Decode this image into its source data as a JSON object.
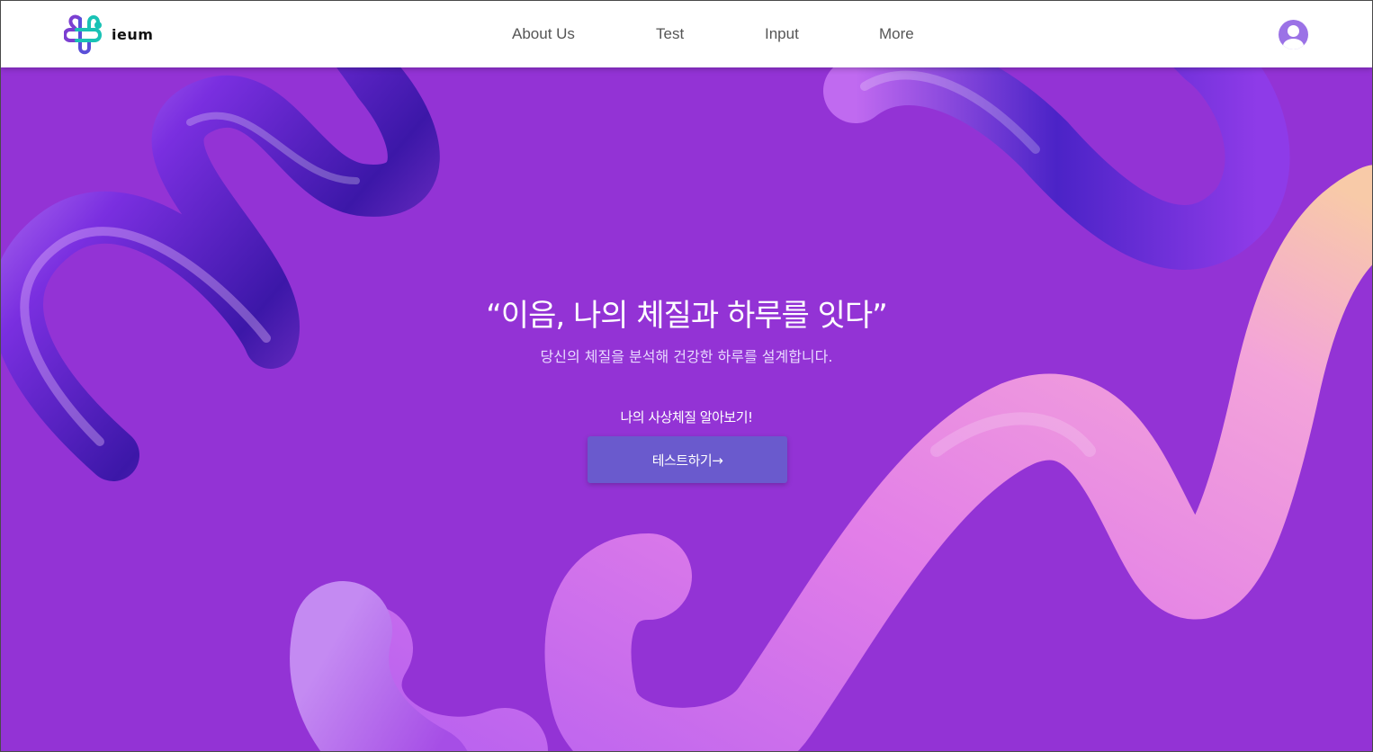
{
  "brand": {
    "name": "ieum",
    "logo_icon": "clover-knot-logo",
    "colors": {
      "logo_teal": "#19c2b5",
      "logo_purple": "#7b3fd1"
    }
  },
  "nav": {
    "items": [
      {
        "label": "About Us"
      },
      {
        "label": "Test"
      },
      {
        "label": "Input"
      },
      {
        "label": "More"
      }
    ],
    "profile_icon": "user-profile-icon"
  },
  "hero": {
    "title": "“이음, 나의 체질과 하루를 잇다”",
    "subtitle": "당신의 체질을 분석해 건강한 하루를 설계합니다.",
    "cta_label": "나의 사상체질 알아보기!",
    "cta_button": "테스트하기→",
    "colors": {
      "background": "#9333d5",
      "button": "#6a5acd"
    }
  }
}
